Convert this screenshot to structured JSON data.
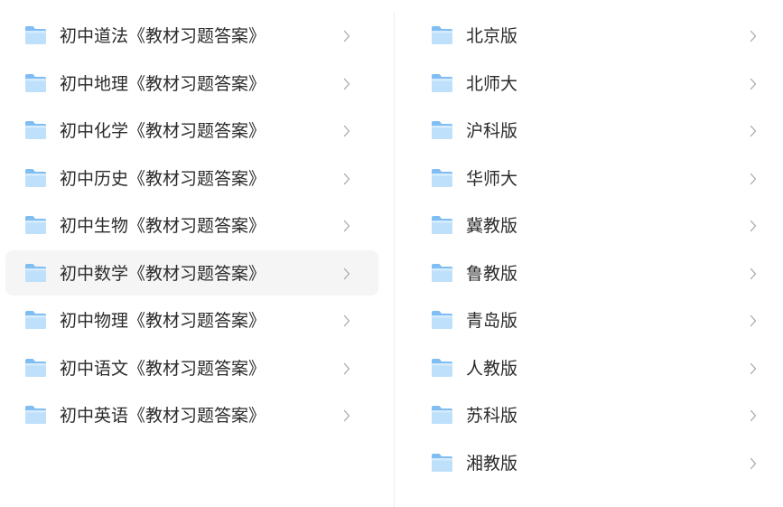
{
  "left_list": {
    "items": [
      {
        "label": "初中道法《教材习题答案》"
      },
      {
        "label": "初中地理《教材习题答案》"
      },
      {
        "label": "初中化学《教材习题答案》"
      },
      {
        "label": "初中历史《教材习题答案》"
      },
      {
        "label": "初中生物《教材习题答案》"
      },
      {
        "label": "初中数学《教材习题答案》"
      },
      {
        "label": "初中物理《教材习题答案》"
      },
      {
        "label": "初中语文《教材习题答案》"
      },
      {
        "label": "初中英语《教材习题答案》"
      }
    ],
    "selected_index": 5
  },
  "right_list": {
    "items": [
      {
        "label": "北京版"
      },
      {
        "label": "北师大"
      },
      {
        "label": "沪科版"
      },
      {
        "label": "华师大"
      },
      {
        "label": "冀教版"
      },
      {
        "label": "鲁教版"
      },
      {
        "label": "青岛版"
      },
      {
        "label": "人教版"
      },
      {
        "label": "苏科版"
      },
      {
        "label": "湘教版"
      }
    ]
  },
  "icons": {
    "item_icon": "folder-icon",
    "arrow_icon": "chevron-right-icon"
  },
  "colors": {
    "folder_light": "#bfe0fb",
    "folder_dark": "#7fbdf2",
    "chevron": "#a9a9a9",
    "selected_row_bg": "#f5f5f6",
    "text": "#2b2b2b"
  }
}
